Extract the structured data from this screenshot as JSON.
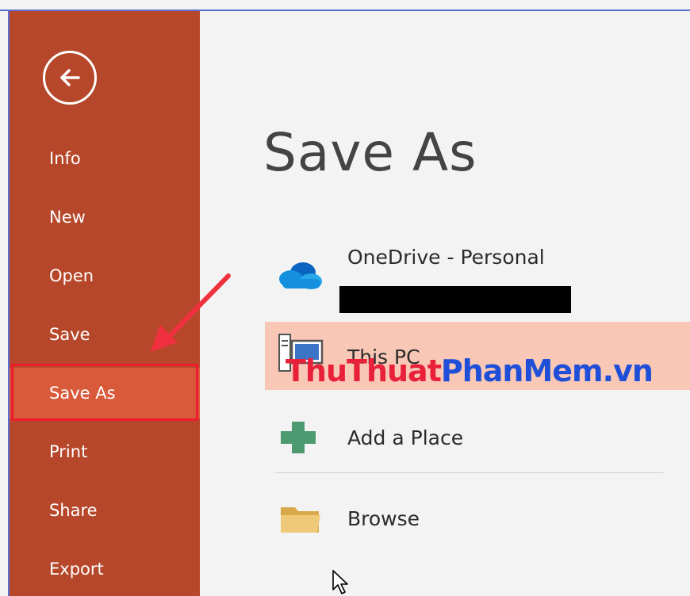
{
  "sidebar": {
    "items": [
      {
        "label": "Info"
      },
      {
        "label": "New"
      },
      {
        "label": "Open"
      },
      {
        "label": "Save"
      },
      {
        "label": "Save As"
      },
      {
        "label": "Print"
      },
      {
        "label": "Share"
      },
      {
        "label": "Export"
      }
    ],
    "active_index": 4
  },
  "main": {
    "title": "Save As",
    "places": [
      {
        "label": "OneDrive - Personal",
        "icon": "onedrive-cloud-icon"
      },
      {
        "label": "This PC",
        "icon": "computer-icon"
      },
      {
        "label": "Add a Place",
        "icon": "plus-icon"
      },
      {
        "label": "Browse",
        "icon": "folder-icon"
      }
    ]
  },
  "watermark": {
    "part1": "ThuThuat",
    "part2": "PhanMem",
    "part3": ".vn"
  },
  "colors": {
    "sidebar": "#b7472a",
    "active_item": "#d85a3a",
    "selected_place": "#f8c7b5",
    "annotation": "#f21b2d"
  }
}
